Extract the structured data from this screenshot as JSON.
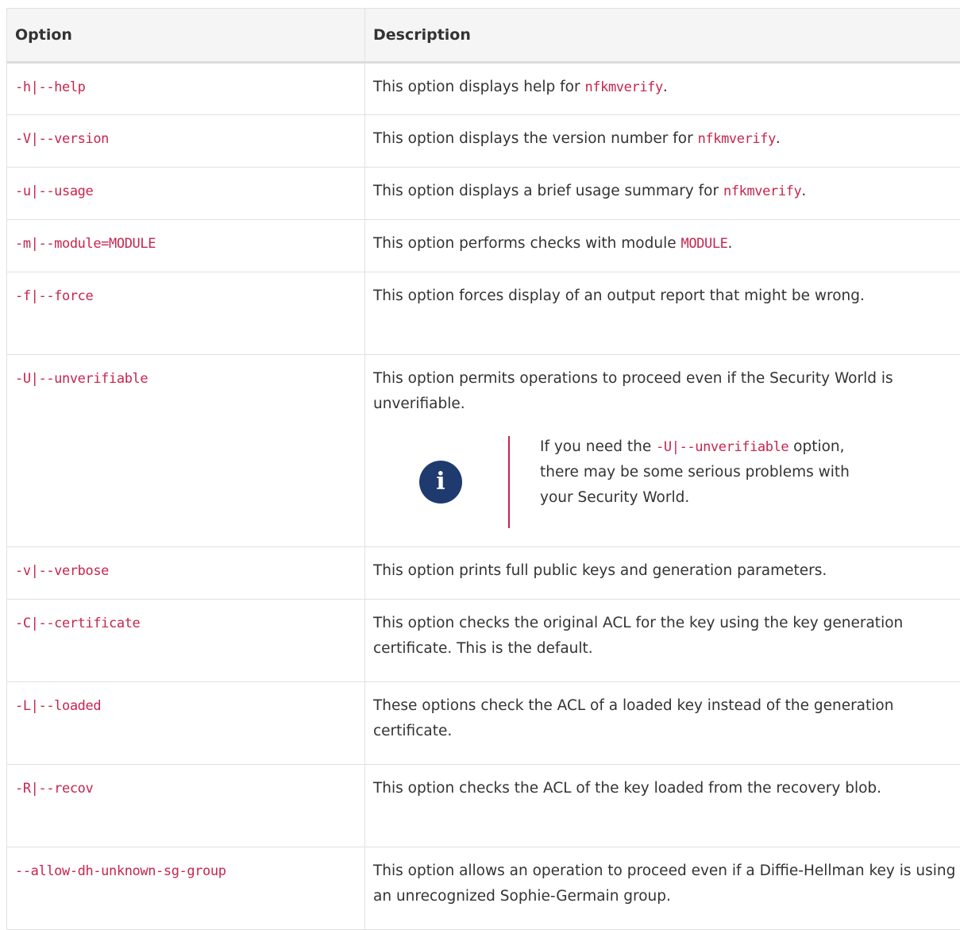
{
  "table": {
    "headers": {
      "option": "Option",
      "description": "Description"
    },
    "rows": [
      {
        "option": "-h|--help",
        "desc_pre": "This option displays help for ",
        "desc_code": "nfkmverify",
        "desc_post": "."
      },
      {
        "option": "-V|--version",
        "desc_pre": "This option displays the version number for ",
        "desc_code": "nfkmverify",
        "desc_post": "."
      },
      {
        "option": "-u|--usage",
        "desc_pre": "This option displays a brief usage summary for ",
        "desc_code": "nfkmverify",
        "desc_post": "."
      },
      {
        "option": "-m|--module=MODULE",
        "desc_pre": "This option performs checks with module ",
        "desc_code": "MODULE",
        "desc_post": "."
      },
      {
        "option": "-f|--force",
        "desc": "This option forces display of an output report that might be wrong."
      },
      {
        "option": "-U|--unverifiable",
        "desc": "This option permits operations to proceed even if the Security World is unverifiable.",
        "note": {
          "icon": "info-icon",
          "text_pre": "If you need the ",
          "text_code": "-U|--unverifiable",
          "text_post": " option, there may be some serious problems with your Security World."
        }
      },
      {
        "option": "-v|--verbose",
        "desc": "This option prints full public keys and generation parameters."
      },
      {
        "option": "-C|--certificate",
        "desc": "This option checks the original ACL for the key using the key generation certificate. This is the default."
      },
      {
        "option": "-L|--loaded",
        "desc": "These options check the ACL of a loaded key instead of the generation certificate."
      },
      {
        "option": "-R|--recov",
        "desc": "This option checks the ACL of the key loaded from the recovery blob."
      },
      {
        "option": "--allow-dh-unknown-sg-group",
        "desc": "This option allows an operation to proceed even if a Diffie-Hellman key is using an unrecognized Sophie-Germain group."
      }
    ]
  },
  "colors": {
    "code": "#c7254e",
    "header_bg": "#f5f5f5",
    "info_icon_bg": "#1f3a6e",
    "border": "#e1e1e1"
  }
}
